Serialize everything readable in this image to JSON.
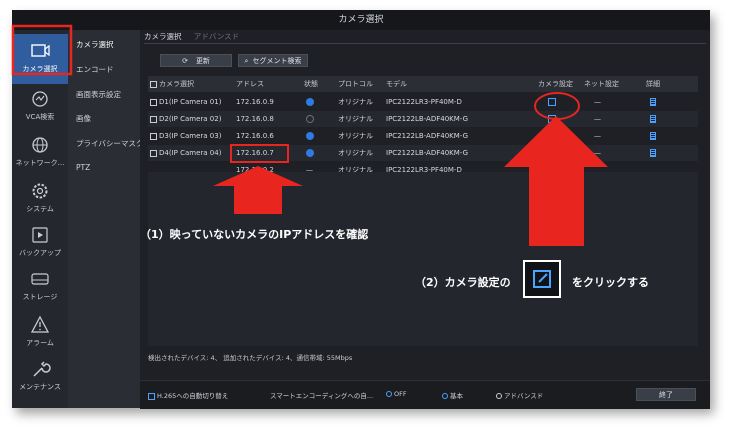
{
  "window": {
    "title": "カメラ選択"
  },
  "left_nav": {
    "items": [
      {
        "label": "カメラ選択",
        "icon": "camera-icon",
        "active": true
      },
      {
        "label": "VCA検索",
        "icon": "vca-search-icon"
      },
      {
        "label": "ネットワーク...",
        "icon": "globe-icon"
      },
      {
        "label": "システム",
        "icon": "gear-icon"
      },
      {
        "label": "バックアップ",
        "icon": "backup-icon"
      },
      {
        "label": "ストレージ",
        "icon": "storage-icon"
      },
      {
        "label": "アラーム",
        "icon": "alarm-icon"
      },
      {
        "label": "メンテナンス",
        "icon": "wrench-icon"
      }
    ]
  },
  "sub_nav": {
    "items": [
      {
        "label": "カメラ選択",
        "active": true
      },
      {
        "label": "エンコード"
      },
      {
        "label": "画面表示設定"
      },
      {
        "label": "画像"
      },
      {
        "label": "プライバシーマスク"
      },
      {
        "label": "PTZ"
      }
    ]
  },
  "tabs": [
    {
      "label": "カメラ選択"
    },
    {
      "label": "アドバンスド"
    }
  ],
  "toolbar": {
    "refresh_label": "更新",
    "segment_search_label": "セグメント検索"
  },
  "table": {
    "headers": [
      "カメラ選択",
      "アドレス",
      "状態",
      "プロトコル",
      "モデル",
      "カメラ設定",
      "ネット設定",
      "詳細"
    ],
    "rows": [
      {
        "name": "D1(IP Camera 01)",
        "address": "172.16.0.9",
        "status": "on",
        "protocol": "オリジナル",
        "model": "IPC2122LR3-PF40M-D",
        "net": "—"
      },
      {
        "name": "D2(IP Camera 02)",
        "address": "172.16.0.8",
        "status": "off",
        "protocol": "オリジナル",
        "model": "IPC2122LB-ADF40KM-G",
        "net": "—"
      },
      {
        "name": "D3(IP Camera 03)",
        "address": "172.16.0.6",
        "status": "on",
        "protocol": "オリジナル",
        "model": "IPC2122LB-ADF40KM-G",
        "net": "—"
      },
      {
        "name": "D4(IP Camera 04)",
        "address": "172.16.0.7",
        "status": "on",
        "protocol": "オリジナル",
        "model": "IPC2122LB-ADF40KM-G",
        "net": "—"
      },
      {
        "name": "",
        "address": "172.16.0.2",
        "status": "—",
        "protocol": "オリジナル",
        "model": "IPC2122LR3-PF40M-D",
        "net": ""
      }
    ]
  },
  "status_text": "検出されたデバイス: 4、 追加されたデバイス: 4、通信帯域: 55Mbps",
  "bottom": {
    "h265_label": "H.265への自動切り替え",
    "smart_label": "スマートエンコーディングへの自...",
    "off_label": "OFF",
    "basic_label": "基本",
    "advanced_label": "アドバンスド",
    "exit_label": "終了"
  },
  "annotations": {
    "step1": "（1）映っていないカメラのIPアドレスを確認",
    "step2_prefix": "（2）カメラ設定の",
    "step2_suffix": "をクリックする"
  },
  "colors": {
    "annotation_red": "#e8261f",
    "accent_blue": "#2f5d9e"
  }
}
